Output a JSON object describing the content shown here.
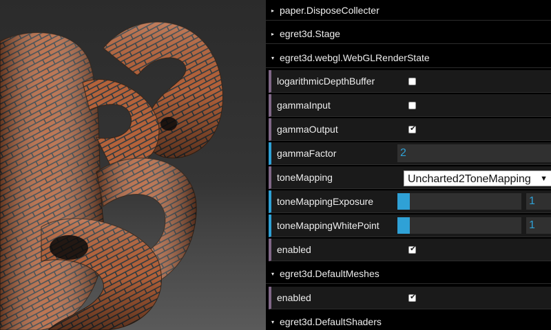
{
  "folders": {
    "dispose": {
      "title": "paper.DisposeCollecter",
      "expanded": false
    },
    "stage": {
      "title": "egret3d.Stage",
      "expanded": false
    },
    "render_state": {
      "title": "egret3d.webgl.WebGLRenderState",
      "expanded": true
    },
    "default_meshes": {
      "title": "egret3d.DefaultMeshes",
      "expanded": true
    },
    "default_shaders": {
      "title": "egret3d.DefaultShaders",
      "expanded": true
    }
  },
  "render_state": {
    "logarithmic": {
      "label": "logarithmicDepthBuffer",
      "checked": false
    },
    "gamma_input": {
      "label": "gammaInput",
      "checked": false
    },
    "gamma_output": {
      "label": "gammaOutput",
      "checked": true
    },
    "gamma_factor": {
      "label": "gammaFactor",
      "value": "2"
    },
    "tone_mapping": {
      "label": "toneMapping",
      "value": "Uncharted2ToneMapping"
    },
    "exposure": {
      "label": "toneMappingExposure",
      "value": "1",
      "fill_fraction": 0.1
    },
    "white_point": {
      "label": "toneMappingWhitePoint",
      "value": "1",
      "fill_fraction": 0.1
    },
    "enabled": {
      "label": "enabled",
      "checked": true
    }
  },
  "default_meshes": {
    "enabled": {
      "label": "enabled",
      "checked": true
    }
  },
  "icons": {
    "collapsed": "▸",
    "expanded": "▾",
    "check": "✔",
    "dropdown": "▼"
  },
  "colors": {
    "bool_accent": "#806787",
    "number_accent": "#2fa1d6",
    "panel_bg": "#1a1a1a"
  }
}
